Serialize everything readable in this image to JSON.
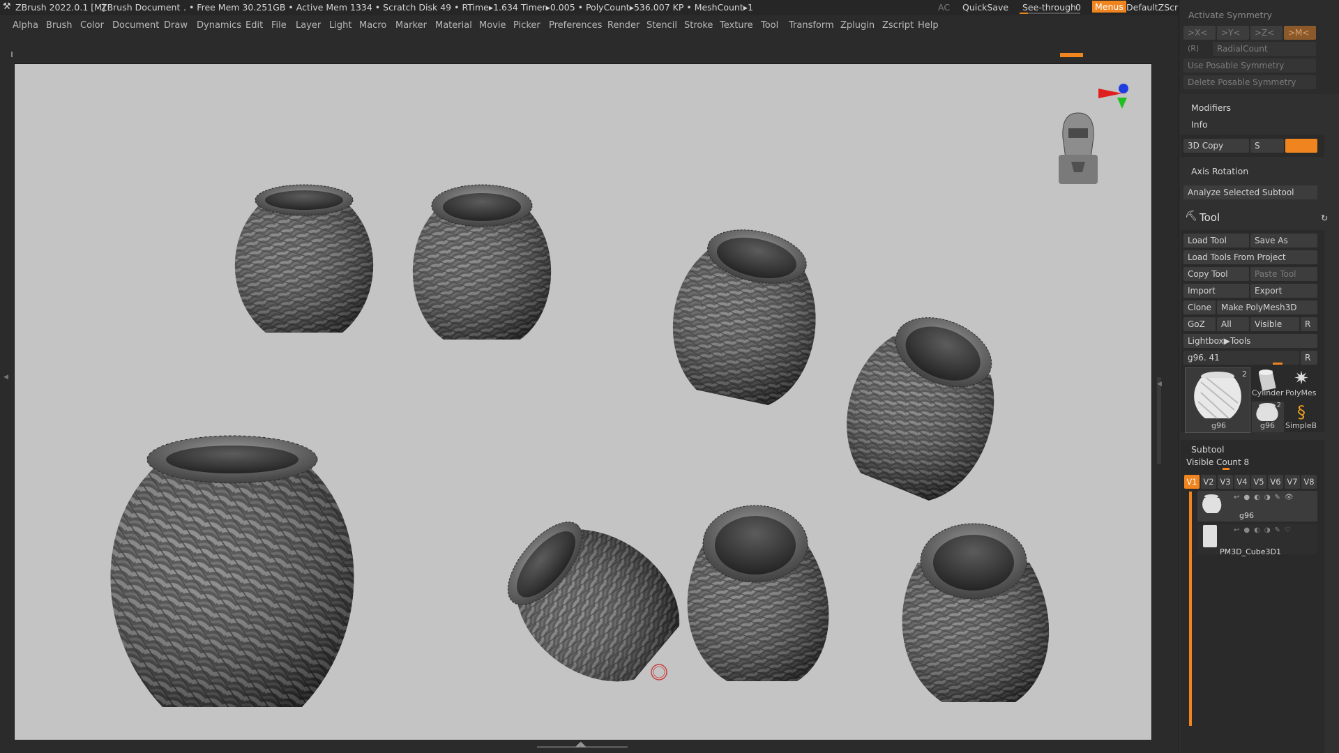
{
  "title_bar": {
    "app": "ZBrush 2022.0.1 [M]",
    "document": "ZBrush Document",
    "stats": ". • Free Mem 30.251GB • Active Mem 1334 • Scratch Disk 49 •  RTime▸1.634 Timer▸0.005 • PolyCount▸536.007 KP  • MeshCount▸1",
    "ac": "AC",
    "quicksave": "QuickSave",
    "see_through_label": "See-through",
    "see_through_value": "0",
    "menus": "Menus",
    "default_zscript": "DefaultZScript"
  },
  "menu_bar": [
    "Alpha",
    "Brush",
    "Color",
    "Document",
    "Draw",
    "Dynamics",
    "Edit",
    "File",
    "Layer",
    "Light",
    "Macro",
    "Marker",
    "Material",
    "Movie",
    "Picker",
    "Preferences",
    "Render",
    "Stencil",
    "Stroke",
    "Texture",
    "Tool",
    "Transform",
    "Zplugin",
    "Zscript",
    "Help"
  ],
  "right_panel": {
    "activate_symmetry": "Activate Symmetry",
    "sym_x": ">X<",
    "sym_y": ">Y<",
    "sym_z": ">Z<",
    "sym_m": ">M<",
    "r_label": "(R)",
    "radial_count": "RadialCount",
    "use_posable": "Use Posable Symmetry",
    "delete_posable": "Delete Posable Symmetry",
    "modifiers": "Modifiers",
    "info": "Info",
    "copy3d": "3D Copy",
    "s_label": "S",
    "axis_rotation": "Axis Rotation",
    "analyze_subtool": "Analyze Selected Subtool",
    "tool_title": "Tool",
    "load_tool": "Load Tool",
    "save_as": "Save As",
    "load_from_project": "Load Tools From Project",
    "copy_tool": "Copy Tool",
    "paste_tool": "Paste Tool",
    "import": "Import",
    "export": "Export",
    "clone": "Clone",
    "make_polymesh": "Make PolyMesh3D",
    "goz": "GoZ",
    "all": "All",
    "visible": "Visible",
    "r": "R",
    "lightbox_tools": "Lightbox▶Tools",
    "current_tool_slider": "g96. 41",
    "thumb_main_label": "g96",
    "thumb_main_count": "2",
    "thumb_cylinder": "Cylinder",
    "thumb_polymesh": "PolyMes",
    "thumb_small_g96": "g96",
    "thumb_small_count": "2",
    "thumb_simpleb": "SimpleB",
    "subtool_title": "Subtool",
    "visible_count": "Visible Count 8",
    "visibility_sets": [
      "V1",
      "V2",
      "V3",
      "V4",
      "V5",
      "V6",
      "V7",
      "V8"
    ],
    "subtools": [
      "g96",
      "PM3D_Cube3D1"
    ]
  },
  "colors": {
    "accent": "#f08520",
    "viewport_bg": "#c4c4c4",
    "panel_bg": "#303030"
  }
}
